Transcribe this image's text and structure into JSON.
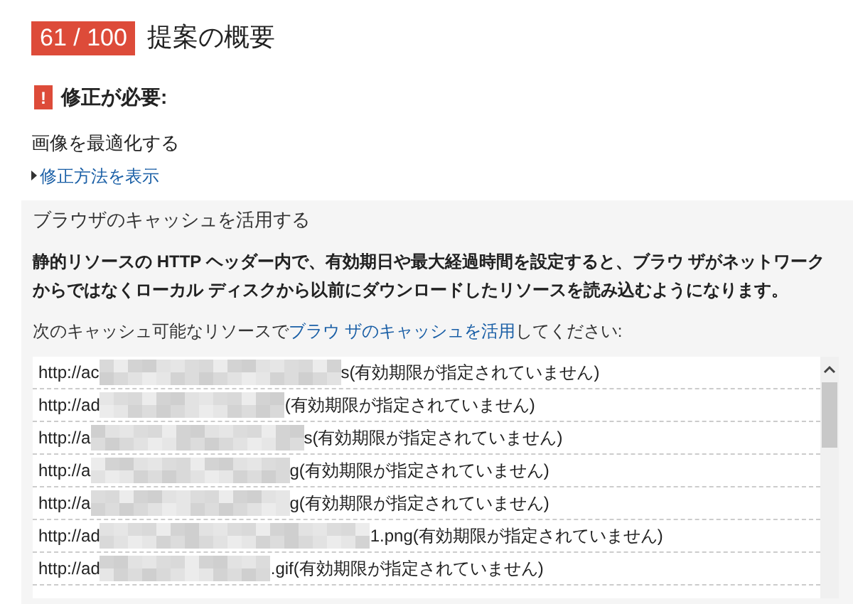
{
  "header": {
    "score": "61 / 100",
    "title": "提案の概要"
  },
  "warning": {
    "icon": "!",
    "label": "修正が必要:"
  },
  "rule": {
    "name": "画像を最適化する",
    "link": "修正方法を表示"
  },
  "panel": {
    "title": "ブラウザのキャッシュを活用する",
    "description": "静的リソースの HTTP ヘッダー内で、有効期日や最大経過時間を設定すると、ブラウ ザがネットワークからではなくローカル ディスクから以前にダウンロードしたリソースを読み込むようになります。",
    "intro_before": "次のキャッシュ可能なリソースで",
    "intro_link": "ブラウ ザのキャッシュを活用",
    "intro_after": "してください:",
    "resources": [
      {
        "url_start": "http://ac",
        "url_end": "s",
        "note": "(有効期限が指定されていません)"
      },
      {
        "url_start": "http://ad",
        "note": "(有効期限が指定されていません)"
      },
      {
        "url_start": "http://a",
        "url_end": "s",
        "note": "(有効期限が指定されていません)"
      },
      {
        "url_start": "http://a",
        "url_end": "g",
        "note": "(有効期限が指定されていません)"
      },
      {
        "url_start": "http://a",
        "url_end": "g",
        "note": "(有効期限が指定されていません)"
      },
      {
        "url_start": "http://ad",
        "url_end": "1.png",
        "note": "(有効期限が指定されていません)"
      },
      {
        "url_start": "http://ad",
        "url_end": ".gif",
        "note": "(有効期限が指定されていません)"
      }
    ]
  }
}
